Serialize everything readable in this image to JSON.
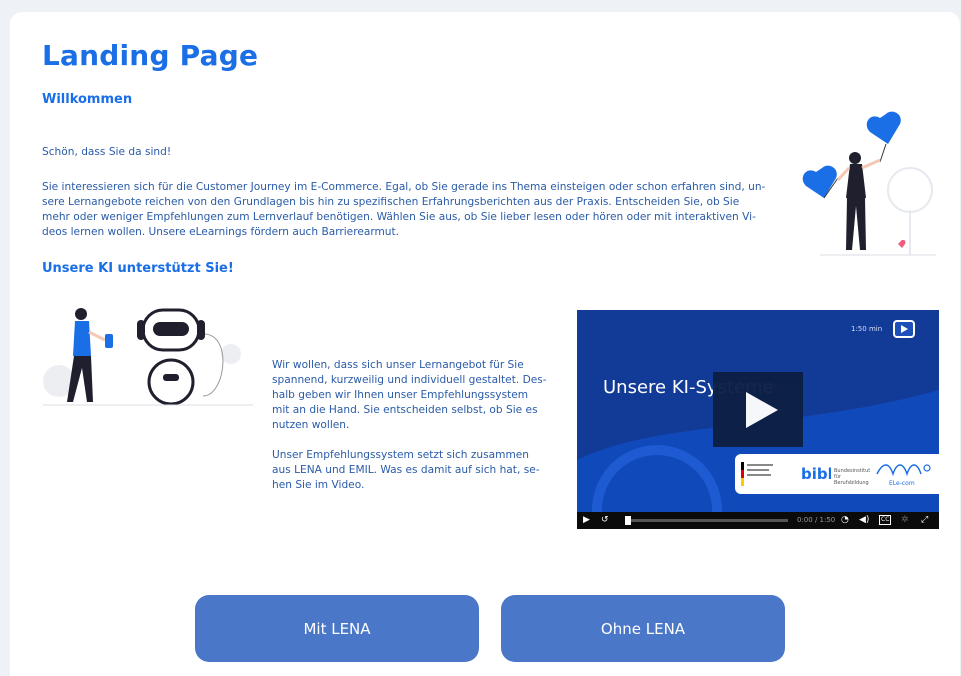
{
  "page": {
    "title": "Landing Page",
    "welcome_heading": "Willkommen",
    "greeting": "Schön, dass Sie da sind!",
    "intro_lines": [
      "Sie interessieren sich für die Customer Journey im E-Commerce. Egal, ob Sie gerade ins Thema einsteigen oder schon erfahren sind, un-",
      "sere Lernangebote reichen von den Grundlagen bis hin zu spezifischen Erfahrungsberichten aus der Praxis. Entscheiden Sie, ob Sie",
      "mehr oder weniger Empfehlungen zum Lernverlauf benötigen. Wählen Sie aus, ob Sie lieber lesen oder hören oder mit interaktiven Vi-",
      "deos lernen wollen. Unsere eLearnings fördern auch Barrierearmut."
    ],
    "ai_heading": "Unsere KI unterstützt Sie!",
    "ai_para1_lines": [
      "Wir wollen, dass sich unser Lernangebot für Sie",
      "spannend, kurzweilig und individuell gestaltet. Des-",
      "halb geben wir Ihnen unser Empfehlungssystem",
      "mit an die Hand. Sie entscheiden selbst, ob Sie es",
      "nutzen wollen."
    ],
    "ai_para2_lines": [
      "Unser Empfehlungssystem setzt sich zusammen",
      "aus LENA und EMIL. Was es damit auf sich hat, se-",
      "hen Sie im Video."
    ]
  },
  "video": {
    "title": "Unsere KI-Systeme",
    "duration": "1:50 min",
    "time": "0:00 / 1:50",
    "logo_text_1": "Bundesinstitut für Berufsbildung",
    "logo_text_2": "ELe-com",
    "cc": "CC"
  },
  "buttons": {
    "with_lena": "Mit LENA",
    "without_lena": "Ohne LENA"
  },
  "colors": {
    "accent": "#1a6ee6",
    "button": "#4a77c7",
    "video_bg": "#123a97"
  }
}
